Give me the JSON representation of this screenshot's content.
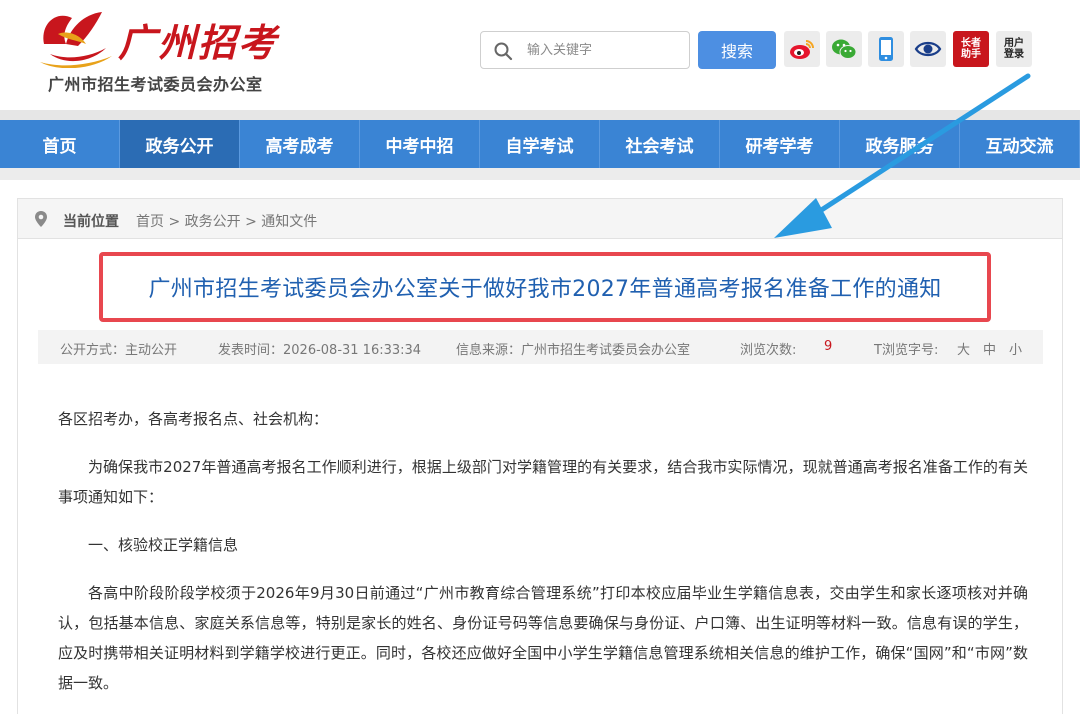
{
  "header": {
    "logo_text": "广州招考",
    "org_name": "广州市招生考试委员会办公室",
    "search_placeholder": "输入关键字",
    "search_button": "搜索",
    "icons": [
      "weibo-icon",
      "wechat-icon",
      "mobile-icon",
      "eye-icon"
    ],
    "assistant_label_1": "长者",
    "assistant_label_2": "助手",
    "login_label_1": "用户",
    "login_label_2": "登录"
  },
  "nav": {
    "items": [
      "首页",
      "政务公开",
      "高考成考",
      "中考中招",
      "自学考试",
      "社会考试",
      "研考学考",
      "政务服务",
      "互动交流"
    ],
    "active_index": 1
  },
  "breadcrumb": {
    "label": "当前位置",
    "path": [
      "首页",
      "政务公开",
      "通知文件"
    ],
    "separator": ">"
  },
  "article": {
    "title": "广州市招生考试委员会办公室关于做好我市2027年普通高考报名准备工作的通知",
    "meta": {
      "disclosure": "公开方式：主动公开",
      "published": "发表时间：2026-08-31 16:33:34",
      "source": "信息来源：广州市招生考试委员会办公室",
      "views_label": "浏览次数:",
      "views_count": "9",
      "font_size_label": "T浏览字号:",
      "font_sizes": [
        "大",
        "中",
        "小"
      ]
    },
    "paragraphs": [
      "各区招考办，各高考报名点、社会机构：",
      "为确保我市2027年普通高考报名工作顺利进行，根据上级部门对学籍管理的有关要求，结合我市实际情况，现就普通高考报名准备工作的有关事项通知如下：",
      "一、核验校正学籍信息",
      "各高中阶段阶段学校须于2026年9月30日前通过“广州市教育综合管理系统”打印本校应届毕业生学籍信息表，交由学生和家长逐项核对并确认，包括基本信息、家庭关系信息等，特别是家长的姓名、身份证号码等信息要确保与身份证、户口簿、出生证明等材料一致。信息有误的学生，应及时携带相关证明材料到学籍学校进行更正。同时，各校还应做好全国中小学生学籍信息管理系统相关信息的维护工作，确保“国网”和“市网”数据一致。"
    ]
  },
  "colors": {
    "nav_blue": "#3a84d4",
    "nav_active": "#2b6cb4",
    "brand_red": "#c8161d",
    "title_blue": "#2060b0",
    "highlight_red": "#e8474f",
    "arrow_blue": "#2a9be0"
  }
}
